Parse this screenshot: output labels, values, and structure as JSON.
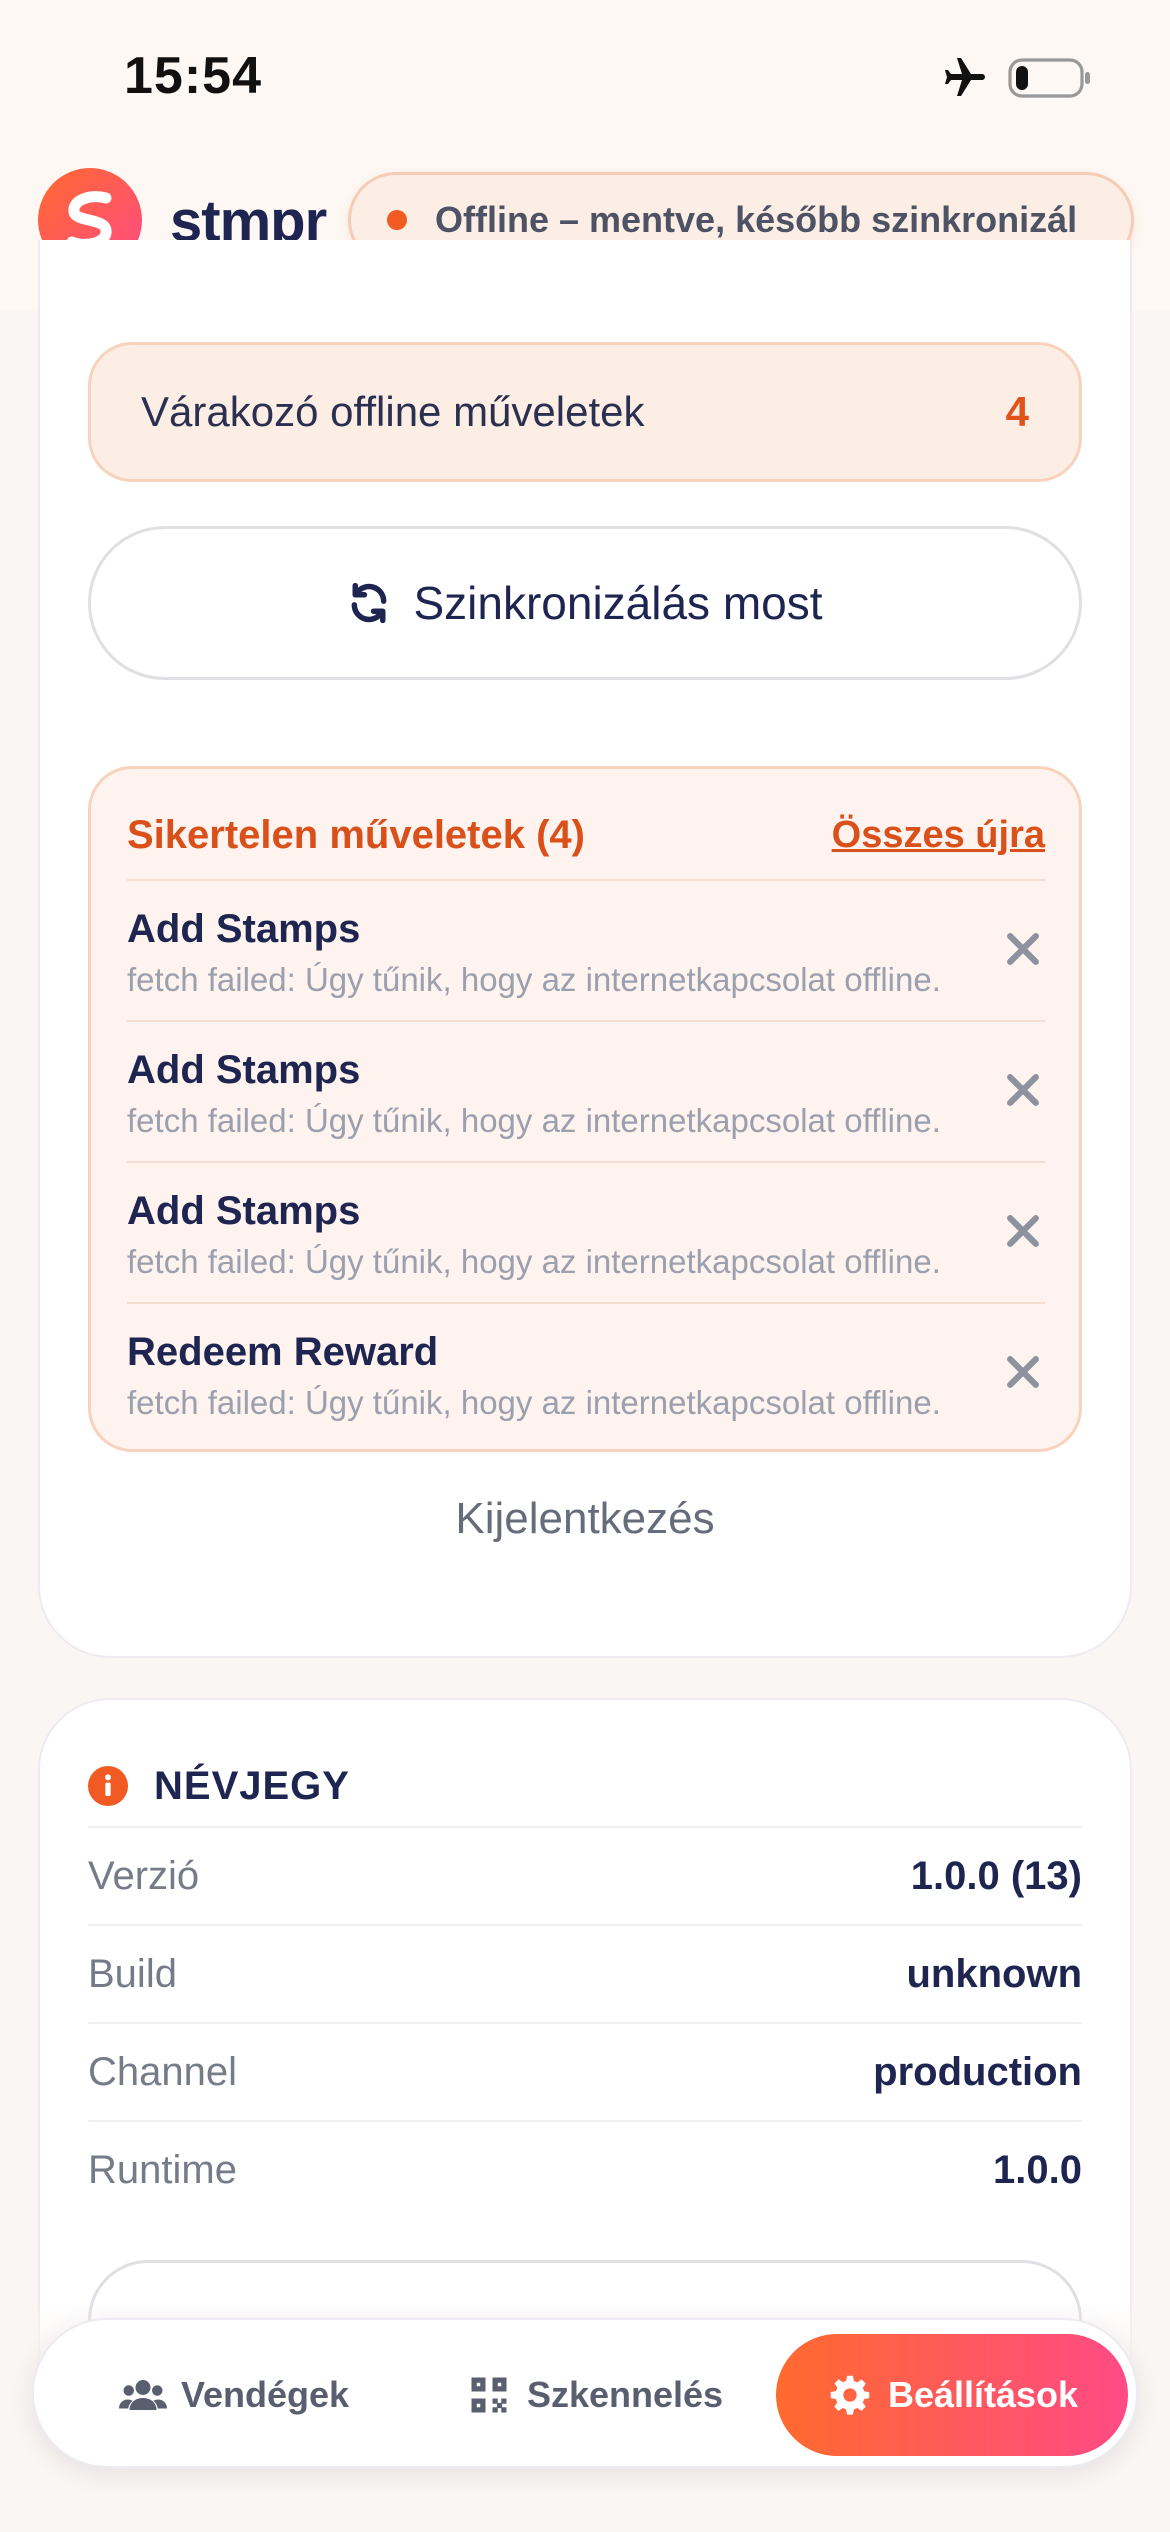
{
  "status_bar": {
    "time": "15:54"
  },
  "header": {
    "brand": "stmpr",
    "offline_banner": "Offline – mentve, később szinkronizál"
  },
  "sync": {
    "pending_label": "Várakozó offline műveletek",
    "pending_count": "4",
    "sync_now_label": "Szinkronizálás most"
  },
  "failed": {
    "title": "Sikertelen műveletek (4)",
    "retry_all_label": "Összes újra",
    "items": [
      {
        "name": "Add Stamps",
        "error": "fetch failed: Úgy tűnik, hogy az internetkapcsolat offline."
      },
      {
        "name": "Add Stamps",
        "error": "fetch failed: Úgy tűnik, hogy az internetkapcsolat offline."
      },
      {
        "name": "Add Stamps",
        "error": "fetch failed: Úgy tűnik, hogy az internetkapcsolat offline."
      },
      {
        "name": "Redeem Reward",
        "error": "fetch failed: Úgy tűnik, hogy az internetkapcsolat offline."
      }
    ]
  },
  "logout_label": "Kijelentkezés",
  "about": {
    "title": "NÉVJEGY",
    "rows": [
      {
        "label": "Verzió",
        "value": "1.0.0 (13)"
      },
      {
        "label": "Build",
        "value": "unknown"
      },
      {
        "label": "Channel",
        "value": "production"
      },
      {
        "label": "Runtime",
        "value": "1.0.0"
      }
    ]
  },
  "tabs": [
    {
      "label": "Vendégek",
      "icon": "users-icon",
      "active": false
    },
    {
      "label": "Szkennelés",
      "icon": "qr-code-icon",
      "active": false
    },
    {
      "label": "Beállítások",
      "icon": "gear-icon",
      "active": true
    }
  ],
  "colors": {
    "accent_orange": "#f15a22",
    "accent_pink": "#ff4a86",
    "navy_text": "#1e2550",
    "error_text": "#d9501b"
  }
}
